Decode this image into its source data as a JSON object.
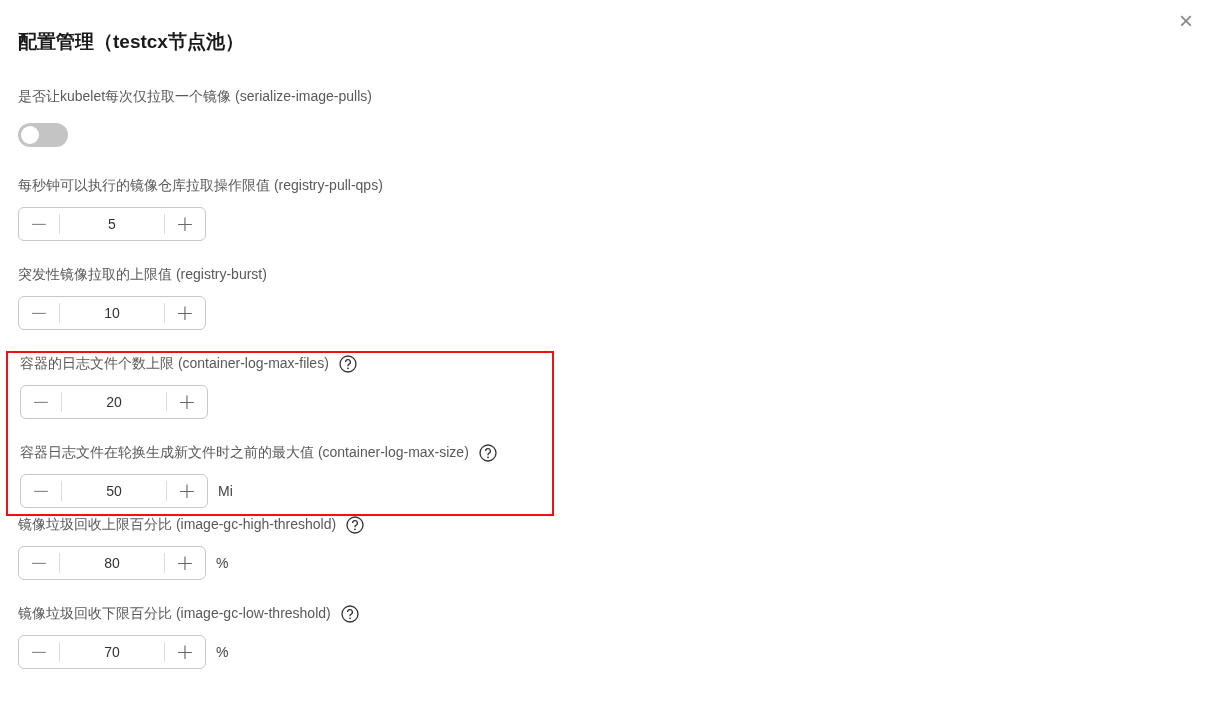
{
  "dialog": {
    "title": "配置管理（testcx节点池）",
    "close": "×"
  },
  "fields": [
    {
      "kind": "switch",
      "label": "是否让kubelet每次仅拉取一个镜像 (serialize-image-pulls)",
      "help": false,
      "on": false,
      "highlighted": false
    },
    {
      "kind": "stepper",
      "label": "每秒钟可以执行的镜像仓库拉取操作限值 (registry-pull-qps)",
      "help": false,
      "value": "5",
      "minus": "−",
      "plus": "+",
      "highlighted": false
    },
    {
      "kind": "stepper",
      "label": "突发性镜像拉取的上限值 (registry-burst)",
      "help": false,
      "value": "10",
      "minus": "−",
      "plus": "+",
      "highlighted": false
    },
    {
      "kind": "stepper",
      "label": "容器的日志文件个数上限 (container-log-max-files)",
      "help": true,
      "value": "20",
      "minus": "−",
      "plus": "+",
      "highlighted": true
    },
    {
      "kind": "stepper",
      "label": "容器日志文件在轮换生成新文件时之前的最大值 (container-log-max-size)",
      "help": true,
      "value": "50",
      "unit": "Mi",
      "minus": "−",
      "plus": "+",
      "highlighted": true
    },
    {
      "kind": "stepper",
      "label": "镜像垃圾回收上限百分比 (image-gc-high-threshold)",
      "help": true,
      "value": "80",
      "unit": "%",
      "minus": "−",
      "plus": "+",
      "highlighted": false
    },
    {
      "kind": "stepper",
      "label": "镜像垃圾回收下限百分比 (image-gc-low-threshold)",
      "help": true,
      "value": "70",
      "unit": "%",
      "minus": "−",
      "plus": "+",
      "highlighted": false
    }
  ]
}
